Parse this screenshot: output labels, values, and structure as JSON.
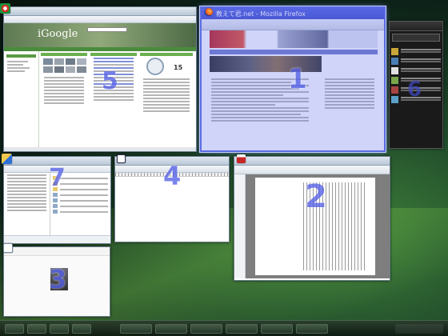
{
  "windows": {
    "browser": {
      "title": "",
      "number": "5",
      "logo_text": "iGoogle",
      "clock_date": "15"
    },
    "firefox": {
      "title": "教えて君.net - Mozilla Firefox",
      "number": "1"
    },
    "sidebar_app": {
      "number": "6"
    },
    "explorer": {
      "number": "7"
    },
    "editor": {
      "number": "4"
    },
    "reader": {
      "number": "2"
    },
    "small": {
      "number": "3"
    }
  },
  "colors": {
    "number_color": "#5561e6",
    "highlight": "#5a6be0"
  }
}
